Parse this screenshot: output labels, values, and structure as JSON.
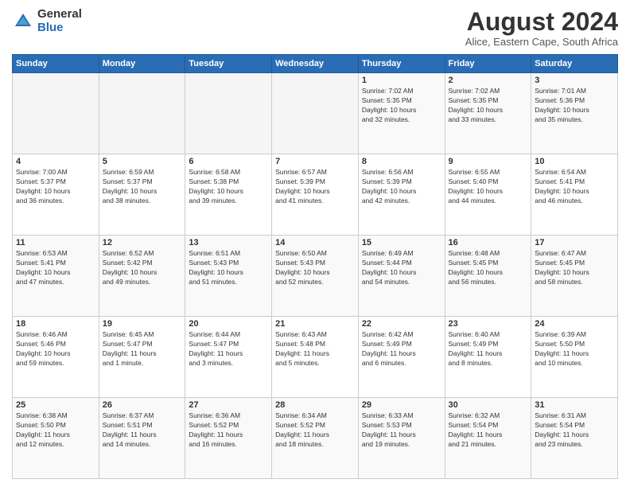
{
  "logo": {
    "general": "General",
    "blue": "Blue"
  },
  "title": "August 2024",
  "subtitle": "Alice, Eastern Cape, South Africa",
  "days_header": [
    "Sunday",
    "Monday",
    "Tuesday",
    "Wednesday",
    "Thursday",
    "Friday",
    "Saturday"
  ],
  "weeks": [
    [
      {
        "day": "",
        "info": ""
      },
      {
        "day": "",
        "info": ""
      },
      {
        "day": "",
        "info": ""
      },
      {
        "day": "",
        "info": ""
      },
      {
        "day": "1",
        "info": "Sunrise: 7:02 AM\nSunset: 5:35 PM\nDaylight: 10 hours\nand 32 minutes."
      },
      {
        "day": "2",
        "info": "Sunrise: 7:02 AM\nSunset: 5:35 PM\nDaylight: 10 hours\nand 33 minutes."
      },
      {
        "day": "3",
        "info": "Sunrise: 7:01 AM\nSunset: 5:36 PM\nDaylight: 10 hours\nand 35 minutes."
      }
    ],
    [
      {
        "day": "4",
        "info": "Sunrise: 7:00 AM\nSunset: 5:37 PM\nDaylight: 10 hours\nand 36 minutes."
      },
      {
        "day": "5",
        "info": "Sunrise: 6:59 AM\nSunset: 5:37 PM\nDaylight: 10 hours\nand 38 minutes."
      },
      {
        "day": "6",
        "info": "Sunrise: 6:58 AM\nSunset: 5:38 PM\nDaylight: 10 hours\nand 39 minutes."
      },
      {
        "day": "7",
        "info": "Sunrise: 6:57 AM\nSunset: 5:39 PM\nDaylight: 10 hours\nand 41 minutes."
      },
      {
        "day": "8",
        "info": "Sunrise: 6:56 AM\nSunset: 5:39 PM\nDaylight: 10 hours\nand 42 minutes."
      },
      {
        "day": "9",
        "info": "Sunrise: 6:55 AM\nSunset: 5:40 PM\nDaylight: 10 hours\nand 44 minutes."
      },
      {
        "day": "10",
        "info": "Sunrise: 6:54 AM\nSunset: 5:41 PM\nDaylight: 10 hours\nand 46 minutes."
      }
    ],
    [
      {
        "day": "11",
        "info": "Sunrise: 6:53 AM\nSunset: 5:41 PM\nDaylight: 10 hours\nand 47 minutes."
      },
      {
        "day": "12",
        "info": "Sunrise: 6:52 AM\nSunset: 5:42 PM\nDaylight: 10 hours\nand 49 minutes."
      },
      {
        "day": "13",
        "info": "Sunrise: 6:51 AM\nSunset: 5:43 PM\nDaylight: 10 hours\nand 51 minutes."
      },
      {
        "day": "14",
        "info": "Sunrise: 6:50 AM\nSunset: 5:43 PM\nDaylight: 10 hours\nand 52 minutes."
      },
      {
        "day": "15",
        "info": "Sunrise: 6:49 AM\nSunset: 5:44 PM\nDaylight: 10 hours\nand 54 minutes."
      },
      {
        "day": "16",
        "info": "Sunrise: 6:48 AM\nSunset: 5:45 PM\nDaylight: 10 hours\nand 56 minutes."
      },
      {
        "day": "17",
        "info": "Sunrise: 6:47 AM\nSunset: 5:45 PM\nDaylight: 10 hours\nand 58 minutes."
      }
    ],
    [
      {
        "day": "18",
        "info": "Sunrise: 6:46 AM\nSunset: 5:46 PM\nDaylight: 10 hours\nand 59 minutes."
      },
      {
        "day": "19",
        "info": "Sunrise: 6:45 AM\nSunset: 5:47 PM\nDaylight: 11 hours\nand 1 minute."
      },
      {
        "day": "20",
        "info": "Sunrise: 6:44 AM\nSunset: 5:47 PM\nDaylight: 11 hours\nand 3 minutes."
      },
      {
        "day": "21",
        "info": "Sunrise: 6:43 AM\nSunset: 5:48 PM\nDaylight: 11 hours\nand 5 minutes."
      },
      {
        "day": "22",
        "info": "Sunrise: 6:42 AM\nSunset: 5:49 PM\nDaylight: 11 hours\nand 6 minutes."
      },
      {
        "day": "23",
        "info": "Sunrise: 6:40 AM\nSunset: 5:49 PM\nDaylight: 11 hours\nand 8 minutes."
      },
      {
        "day": "24",
        "info": "Sunrise: 6:39 AM\nSunset: 5:50 PM\nDaylight: 11 hours\nand 10 minutes."
      }
    ],
    [
      {
        "day": "25",
        "info": "Sunrise: 6:38 AM\nSunset: 5:50 PM\nDaylight: 11 hours\nand 12 minutes."
      },
      {
        "day": "26",
        "info": "Sunrise: 6:37 AM\nSunset: 5:51 PM\nDaylight: 11 hours\nand 14 minutes."
      },
      {
        "day": "27",
        "info": "Sunrise: 6:36 AM\nSunset: 5:52 PM\nDaylight: 11 hours\nand 16 minutes."
      },
      {
        "day": "28",
        "info": "Sunrise: 6:34 AM\nSunset: 5:52 PM\nDaylight: 11 hours\nand 18 minutes."
      },
      {
        "day": "29",
        "info": "Sunrise: 6:33 AM\nSunset: 5:53 PM\nDaylight: 11 hours\nand 19 minutes."
      },
      {
        "day": "30",
        "info": "Sunrise: 6:32 AM\nSunset: 5:54 PM\nDaylight: 11 hours\nand 21 minutes."
      },
      {
        "day": "31",
        "info": "Sunrise: 6:31 AM\nSunset: 5:54 PM\nDaylight: 11 hours\nand 23 minutes."
      }
    ]
  ]
}
